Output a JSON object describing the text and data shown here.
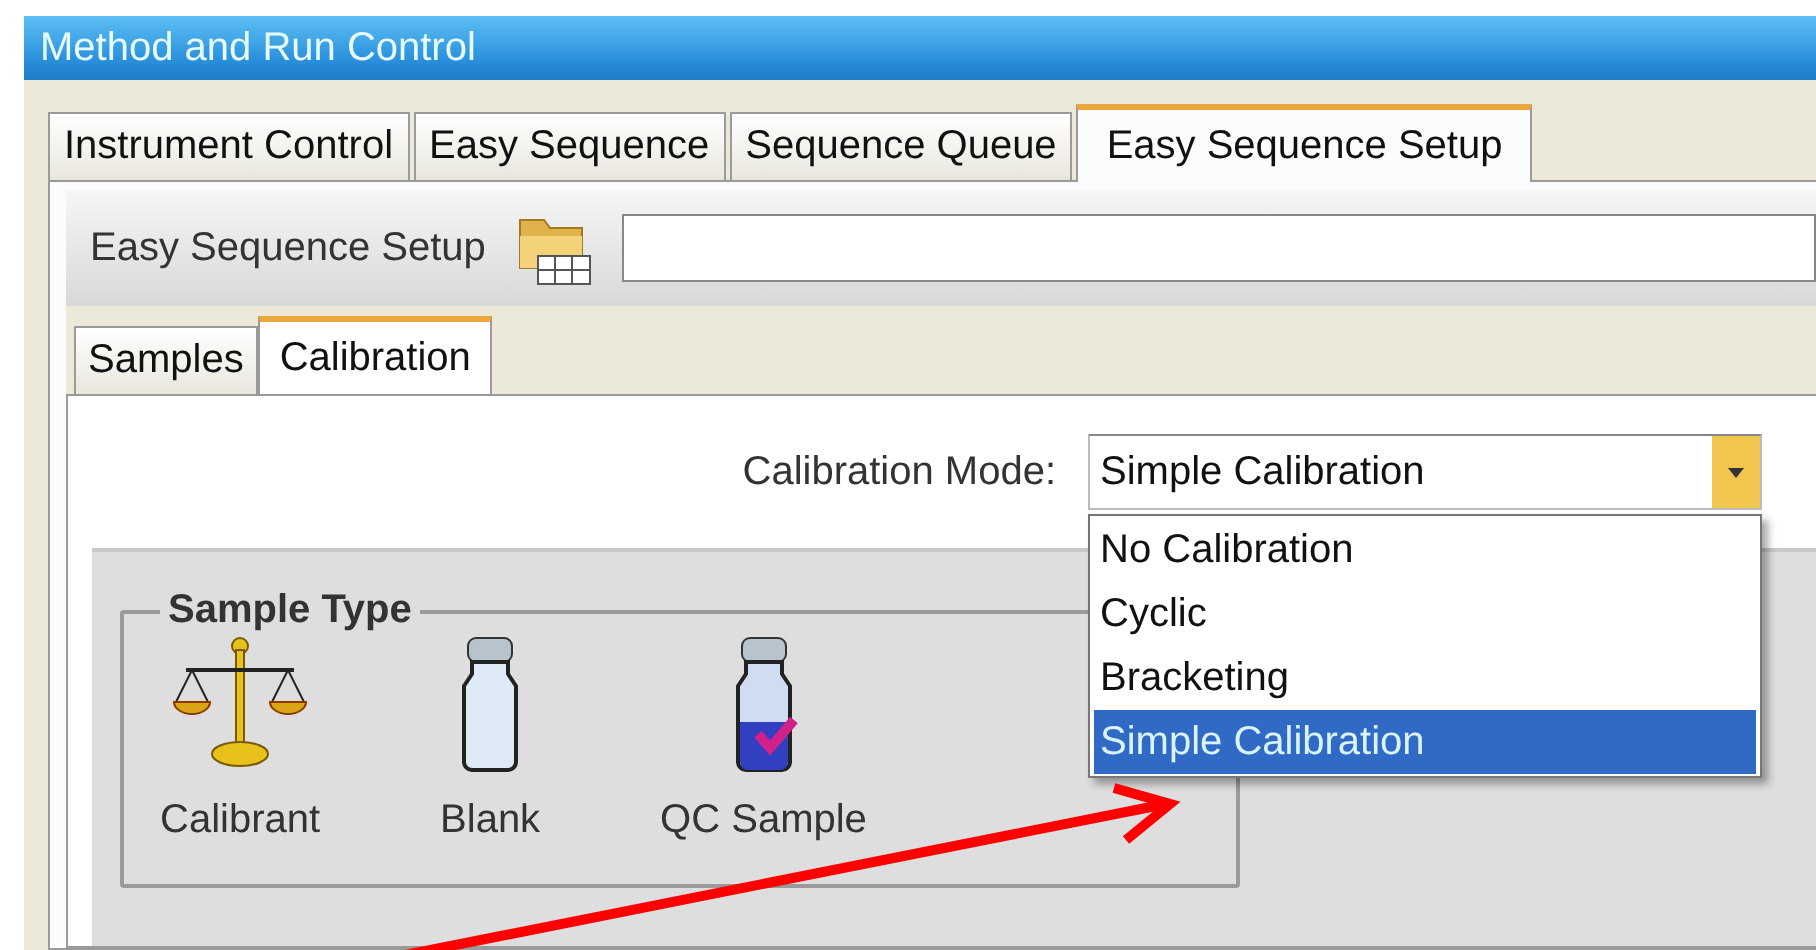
{
  "window": {
    "title": "Method and Run Control"
  },
  "tabs": [
    {
      "label": "Instrument Control",
      "selected": false
    },
    {
      "label": "Easy Sequence",
      "selected": false
    },
    {
      "label": "Sequence Queue",
      "selected": false
    },
    {
      "label": "Easy Sequence Setup",
      "selected": true
    }
  ],
  "toolbar": {
    "label": "Easy Sequence Setup"
  },
  "subtabs": [
    {
      "label": "Samples",
      "selected": false
    },
    {
      "label": "Calibration",
      "selected": true
    }
  ],
  "calibration_mode": {
    "label": "Calibration Mode:",
    "value": "Simple Calibration",
    "expanded": true,
    "options": [
      {
        "label": "No Calibration",
        "selected": false
      },
      {
        "label": "Cyclic",
        "selected": false
      },
      {
        "label": "Bracketing",
        "selected": false
      },
      {
        "label": "Simple Calibration",
        "selected": true
      }
    ]
  },
  "sample_type": {
    "title": "Sample Type",
    "items": [
      {
        "label": "Calibrant",
        "kind": "balance"
      },
      {
        "label": "Blank",
        "kind": "vial"
      },
      {
        "label": "QC Sample",
        "kind": "checked-vial"
      }
    ]
  }
}
